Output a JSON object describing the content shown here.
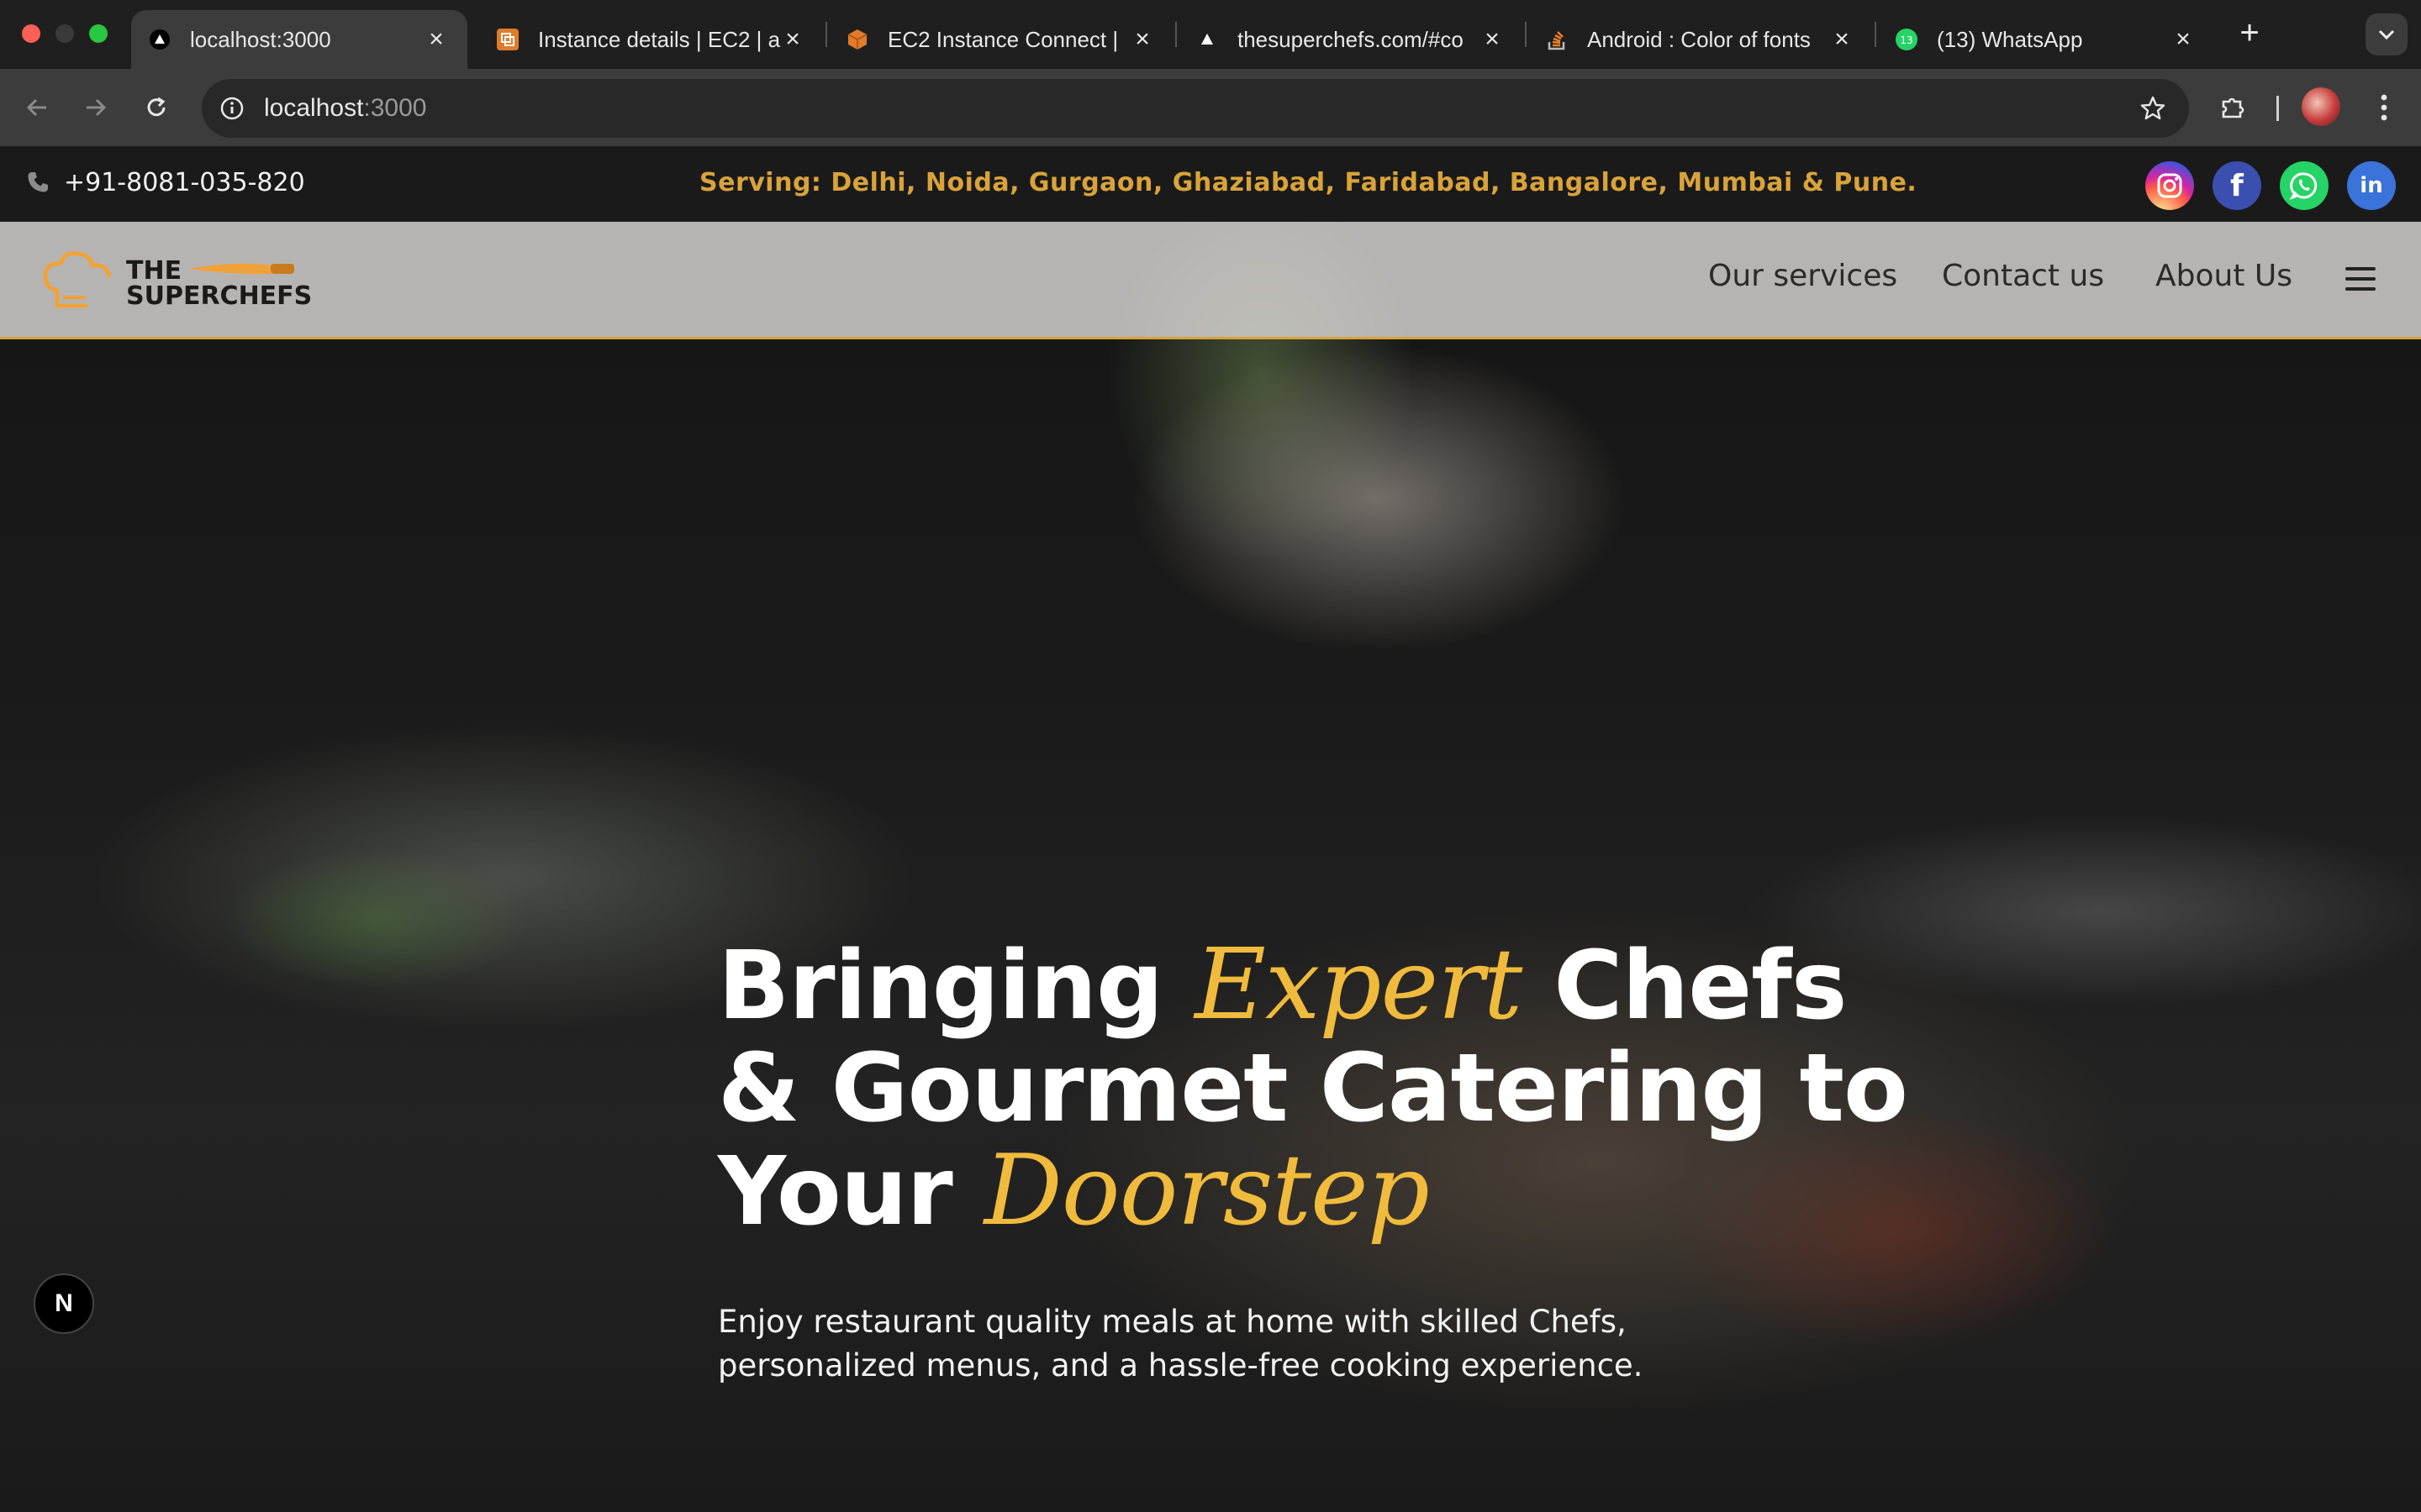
{
  "browser": {
    "tabs": [
      {
        "title": "localhost:3000",
        "icon": "triangle-icon"
      },
      {
        "title": "Instance details | EC2 | a",
        "icon": "aws-ec2-icon"
      },
      {
        "title": "EC2 Instance Connect |",
        "icon": "aws-cube-icon"
      },
      {
        "title": "thesuperchefs.com/#co",
        "icon": "triangle-icon"
      },
      {
        "title": "Android : Color of fonts",
        "icon": "stackoverflow-icon"
      },
      {
        "title": "(13) WhatsApp",
        "icon": "whatsapp-icon",
        "badge": "13"
      }
    ],
    "new_tab_label": "+",
    "url_host": "localhost",
    "url_port": ":3000"
  },
  "topbar": {
    "phone": "+91-8081-035-820",
    "serving": "Serving: Delhi, Noida, Gurgaon, Ghaziabad, Faridabad, Bangalore, Mumbai & Pune.",
    "socials": [
      {
        "name": "instagram-icon",
        "label": ""
      },
      {
        "name": "facebook-icon",
        "label": "f"
      },
      {
        "name": "whatsapp-icon",
        "label": ""
      },
      {
        "name": "linkedin-icon",
        "label": "in"
      }
    ]
  },
  "header": {
    "logo_line1": "THE",
    "logo_line2": "SUPERCHEFS",
    "nav": [
      "Our services",
      "Contact us",
      "About Us"
    ]
  },
  "hero": {
    "line1_a": "Bringing ",
    "line1_accent": "Expert",
    "line1_b": " Chefs",
    "line2": "& Gourmet Catering to",
    "line3_a": "Your ",
    "line3_accent": "Doorstep",
    "subtitle_line1": "Enjoy restaurant quality meals at home with skilled Chefs,",
    "subtitle_line2": "personalized menus, and a hassle-free cooking experience."
  },
  "dev_indicator": "N",
  "colors": {
    "accent": "#f0bb3c",
    "serving_text": "#d9a33a",
    "header_border": "#d9a33a"
  }
}
